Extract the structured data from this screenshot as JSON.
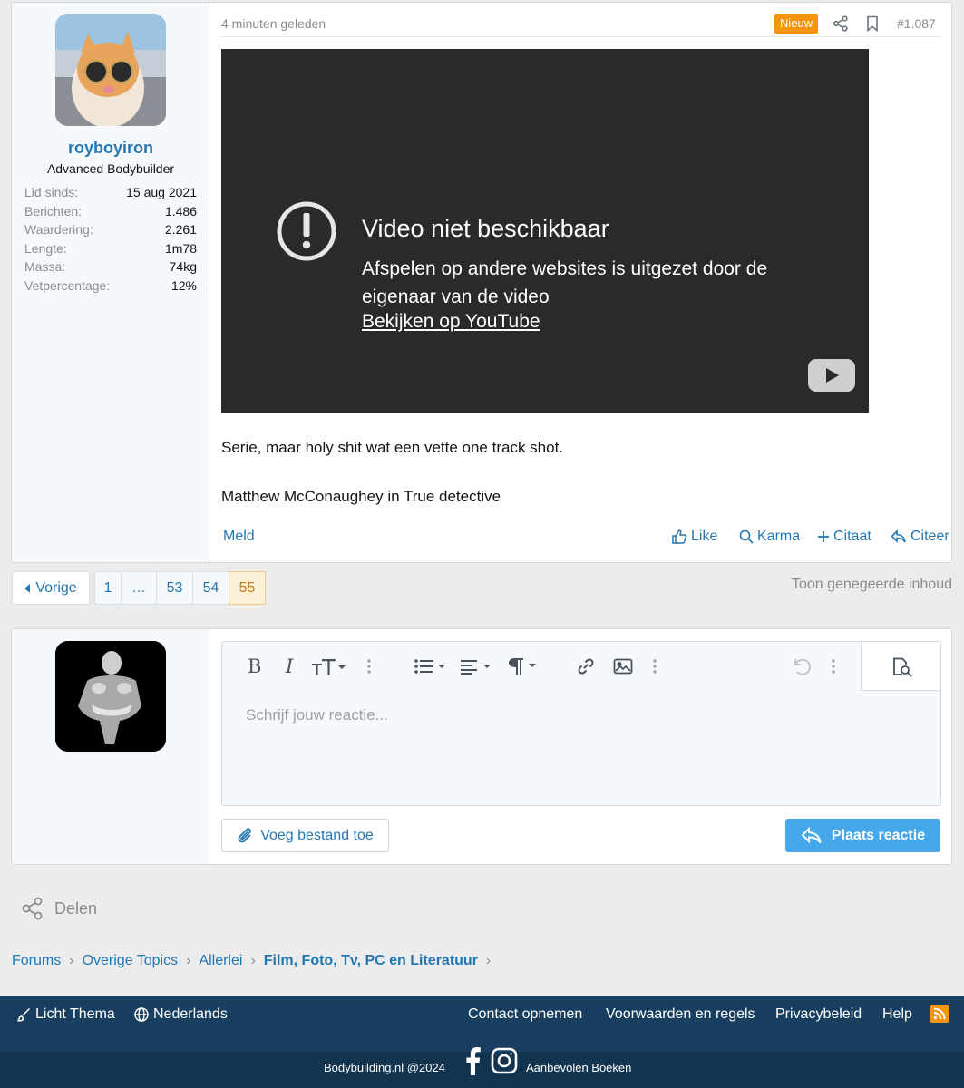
{
  "post": {
    "username": "royboyiron",
    "user_title": "Advanced Bodybuilder",
    "stats": [
      {
        "k": "Lid sinds:",
        "v": "15 aug 2021"
      },
      {
        "k": "Berichten:",
        "v": "1.486"
      },
      {
        "k": "Waardering:",
        "v": "2.261"
      },
      {
        "k": "Lengte:",
        "v": "1m78"
      },
      {
        "k": "Massa:",
        "v": "74kg"
      },
      {
        "k": "Vetpercentage:",
        "v": "12%"
      }
    ],
    "time": "4 minuten geleden",
    "badge": "Nieuw",
    "number": "#1.087",
    "video": {
      "title": "Video niet beschikbaar",
      "description": "Afspelen op andere websites is uitgezet door de eigenaar van de video",
      "link": "Bekijken op YouTube"
    },
    "message": [
      "Serie, maar holy shit wat een vette one track shot.",
      "Matthew McConaughey in True detective"
    ],
    "report": "Meld",
    "actions": {
      "like": "Like",
      "karma": "Karma",
      "quote": "Citaat",
      "reply": "Citeer"
    }
  },
  "pagination": {
    "prev": "Vorige",
    "pages": [
      "1",
      "…",
      "53",
      "54",
      "55"
    ],
    "current": "55",
    "ignored": "Toon genegeerde inhoud"
  },
  "reply": {
    "placeholder": "Schrijf jouw reactie...",
    "attach": "Voeg bestand toe",
    "submit": "Plaats reactie"
  },
  "share_label": "Delen",
  "breadcrumb": [
    "Forums",
    "Overige Topics",
    "Allerlei",
    "Film, Foto, Tv, PC en Literatuur"
  ],
  "footer": {
    "theme": "Licht Thema",
    "language": "Nederlands",
    "links": [
      "Contact opnemen",
      "Voorwaarden en regels",
      "Privacybeleid",
      "Help"
    ],
    "copyright": "Bodybuilding.nl @2024",
    "books": "Aanbevolen Boeken"
  },
  "colors": {
    "accent": "#2577b1",
    "badge": "#f7940f",
    "footer": "#183f5f",
    "button": "#47a7eb"
  }
}
